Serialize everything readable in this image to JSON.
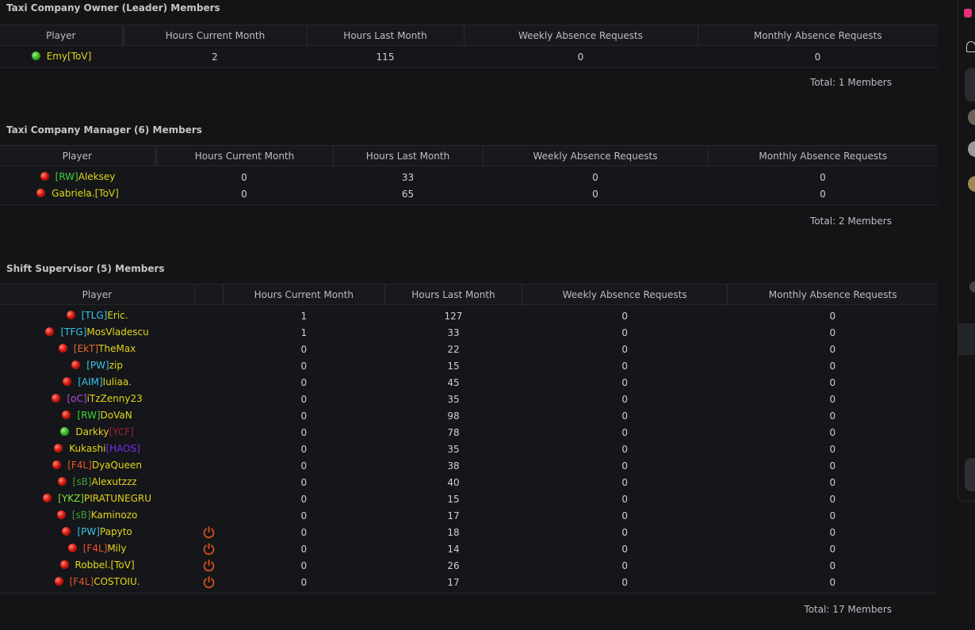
{
  "sections": [
    {
      "title": "Taxi Company Owner (Leader) Members",
      "headers": [
        "Player",
        "Hours Current Month",
        "Hours Last Month",
        "Weekly Absence Requests",
        "Monthly Absence Requests"
      ],
      "rows": [
        {
          "status": "online",
          "tag": "",
          "name": "Emy",
          "suffix": "[ToV]",
          "tag_color": "",
          "name_color": "#e3d51c",
          "suffix_color": "#e3d51c",
          "hours_current": "2",
          "hours_last": "115",
          "weekly": "0",
          "monthly": "0",
          "power": false
        }
      ],
      "total": "Total: 1 Members"
    },
    {
      "title": "Taxi Company Manager (6) Members",
      "headers": [
        "Player",
        "Hours Current Month",
        "Hours Last Month",
        "Weekly Absence Requests",
        "Monthly Absence Requests"
      ],
      "rows": [
        {
          "status": "offline",
          "tag": "[RW]",
          "name": "Aleksey",
          "suffix": "",
          "tag_color": "#3fd43a",
          "name_color": "#e3d51c",
          "suffix_color": "",
          "hours_current": "0",
          "hours_last": "33",
          "weekly": "0",
          "monthly": "0",
          "power": false
        },
        {
          "status": "offline",
          "tag": "",
          "name": "Gabriela.",
          "suffix": "[ToV]",
          "tag_color": "",
          "name_color": "#e3d51c",
          "suffix_color": "#e3d51c",
          "hours_current": "0",
          "hours_last": "65",
          "weekly": "0",
          "monthly": "0",
          "power": false
        }
      ],
      "total": "Total: 2 Members"
    },
    {
      "title": "Shift Supervisor (5) Members",
      "headers": [
        "Player",
        "Hours Current Month",
        "Hours Last Month",
        "Weekly Absence Requests",
        "Monthly Absence Requests"
      ],
      "rows": [
        {
          "status": "offline",
          "tag": "[TLG]",
          "name": "Eric.",
          "suffix": "",
          "tag_color": "#39c6e8",
          "name_color": "#e3d51c",
          "suffix_color": "",
          "hours_current": "1",
          "hours_last": "127",
          "weekly": "0",
          "monthly": "0",
          "power": false
        },
        {
          "status": "offline",
          "tag": "[TFG]",
          "name": "MosVladescu",
          "suffix": "",
          "tag_color": "#39c6e8",
          "name_color": "#e3d51c",
          "suffix_color": "",
          "hours_current": "1",
          "hours_last": "33",
          "weekly": "0",
          "monthly": "0",
          "power": false
        },
        {
          "status": "offline",
          "tag": "[EkT]",
          "name": "TheMax",
          "suffix": "",
          "tag_color": "#e86a2c",
          "name_color": "#e3d51c",
          "suffix_color": "",
          "hours_current": "0",
          "hours_last": "22",
          "weekly": "0",
          "monthly": "0",
          "power": false
        },
        {
          "status": "offline",
          "tag": "[PW]",
          "name": "zip",
          "suffix": "",
          "tag_color": "#39c6e8",
          "name_color": "#e3d51c",
          "suffix_color": "",
          "hours_current": "0",
          "hours_last": "15",
          "weekly": "0",
          "monthly": "0",
          "power": false
        },
        {
          "status": "offline",
          "tag": "[AIM]",
          "name": "Iuliaa.",
          "suffix": "",
          "tag_color": "#39c6e8",
          "name_color": "#e3d51c",
          "suffix_color": "",
          "hours_current": "0",
          "hours_last": "45",
          "weekly": "0",
          "monthly": "0",
          "power": false
        },
        {
          "status": "offline",
          "tag": "[oC]",
          "name": "iTzZenny23",
          "suffix": "",
          "tag_color": "#b04ad8",
          "name_color": "#e3d51c",
          "suffix_color": "",
          "hours_current": "0",
          "hours_last": "35",
          "weekly": "0",
          "monthly": "0",
          "power": false
        },
        {
          "status": "offline",
          "tag": "[RW]",
          "name": "DoVaN",
          "suffix": "",
          "tag_color": "#3fd43a",
          "name_color": "#e3d51c",
          "suffix_color": "",
          "hours_current": "0",
          "hours_last": "98",
          "weekly": "0",
          "monthly": "0",
          "power": false
        },
        {
          "status": "online",
          "tag": "",
          "name": "Darkky",
          "suffix": "[YCF]",
          "tag_color": "",
          "name_color": "#e3d51c",
          "suffix_color": "#a3203a",
          "hours_current": "0",
          "hours_last": "78",
          "weekly": "0",
          "monthly": "0",
          "power": false
        },
        {
          "status": "offline",
          "tag": "",
          "name": "Kukashi",
          "suffix": "[HAOS]",
          "tag_color": "",
          "name_color": "#e3d51c",
          "suffix_color": "#7a2cf0",
          "hours_current": "0",
          "hours_last": "35",
          "weekly": "0",
          "monthly": "0",
          "power": false
        },
        {
          "status": "offline",
          "tag": "[F4L]",
          "name": "DyaQueen",
          "suffix": "",
          "tag_color": "#e8542c",
          "name_color": "#e3d51c",
          "suffix_color": "",
          "hours_current": "0",
          "hours_last": "38",
          "weekly": "0",
          "monthly": "0",
          "power": false
        },
        {
          "status": "offline",
          "tag": "[sB]",
          "name": "Alexutzzz",
          "suffix": "",
          "tag_color": "#3f9e3a",
          "name_color": "#e3d51c",
          "suffix_color": "",
          "hours_current": "0",
          "hours_last": "40",
          "weekly": "0",
          "monthly": "0",
          "power": false
        },
        {
          "status": "offline",
          "tag": "[YKZ]",
          "name": "PIRATUNEGRU",
          "suffix": "",
          "tag_color": "#7ee23c",
          "name_color": "#e3d51c",
          "suffix_color": "",
          "hours_current": "0",
          "hours_last": "15",
          "weekly": "0",
          "monthly": "0",
          "power": false
        },
        {
          "status": "offline",
          "tag": "[sB]",
          "name": "Kaminozo",
          "suffix": "",
          "tag_color": "#3f9e3a",
          "name_color": "#e3d51c",
          "suffix_color": "",
          "hours_current": "0",
          "hours_last": "17",
          "weekly": "0",
          "monthly": "0",
          "power": false
        },
        {
          "status": "offline",
          "tag": "[PW]",
          "name": "Papyto",
          "suffix": "",
          "tag_color": "#39c6e8",
          "name_color": "#e3d51c",
          "suffix_color": "",
          "hours_current": "0",
          "hours_last": "18",
          "weekly": "0",
          "monthly": "0",
          "power": true
        },
        {
          "status": "offline",
          "tag": "[F4L]",
          "name": "Mily",
          "suffix": "",
          "tag_color": "#e8542c",
          "name_color": "#e3d51c",
          "suffix_color": "",
          "hours_current": "0",
          "hours_last": "14",
          "weekly": "0",
          "monthly": "0",
          "power": true
        },
        {
          "status": "offline",
          "tag": "",
          "name": "Robbel.",
          "suffix": "[ToV]",
          "tag_color": "",
          "name_color": "#e3d51c",
          "suffix_color": "#e3d51c",
          "hours_current": "0",
          "hours_last": "26",
          "weekly": "0",
          "monthly": "0",
          "power": true
        },
        {
          "status": "offline",
          "tag": "[F4L]",
          "name": "COSTOIU.",
          "suffix": "",
          "tag_color": "#e8542c",
          "name_color": "#e3d51c",
          "suffix_color": "",
          "hours_current": "0",
          "hours_last": "17",
          "weekly": "0",
          "monthly": "0",
          "power": true
        }
      ],
      "total": "Total: 17 Members"
    }
  ],
  "icons": {
    "power": "power-icon",
    "online": "online-status-icon",
    "offline": "offline-status-icon"
  },
  "colors": {
    "background": "#141417",
    "header_bg": "#18191c",
    "power_icon": "#e0541a"
  }
}
